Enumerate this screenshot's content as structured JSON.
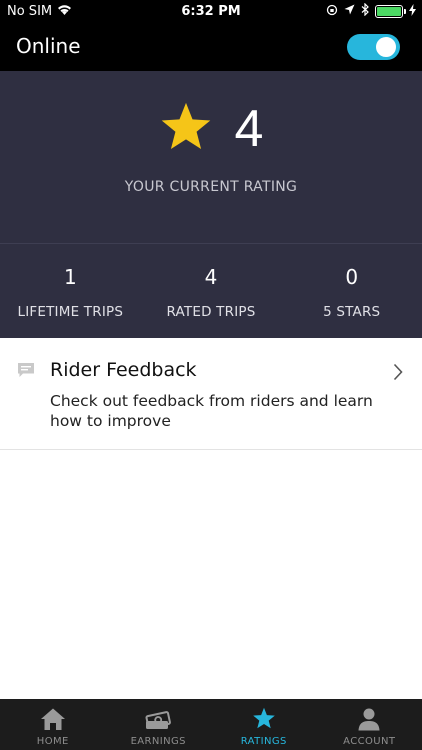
{
  "status_bar": {
    "carrier": "No SIM",
    "time": "6:32 PM"
  },
  "header": {
    "title": "Online",
    "online_toggle_on": true
  },
  "rating": {
    "value": "4",
    "label": "YOUR CURRENT RATING",
    "star_color": "#f5c518"
  },
  "stats": [
    {
      "value": "1",
      "label": "LIFETIME TRIPS"
    },
    {
      "value": "4",
      "label": "RATED TRIPS"
    },
    {
      "value": "0",
      "label": "5 STARS"
    }
  ],
  "feedback": {
    "title": "Rider Feedback",
    "description": "Check out feedback from riders and learn how to improve"
  },
  "tabs": [
    {
      "label": "HOME",
      "icon": "home-icon",
      "active": false
    },
    {
      "label": "EARNINGS",
      "icon": "earnings-icon",
      "active": false
    },
    {
      "label": "RATINGS",
      "icon": "star-icon",
      "active": true
    },
    {
      "label": "ACCOUNT",
      "icon": "account-icon",
      "active": false
    }
  ],
  "colors": {
    "accent": "#27b6dc",
    "panel": "#2f2f41",
    "header": "#000000"
  }
}
